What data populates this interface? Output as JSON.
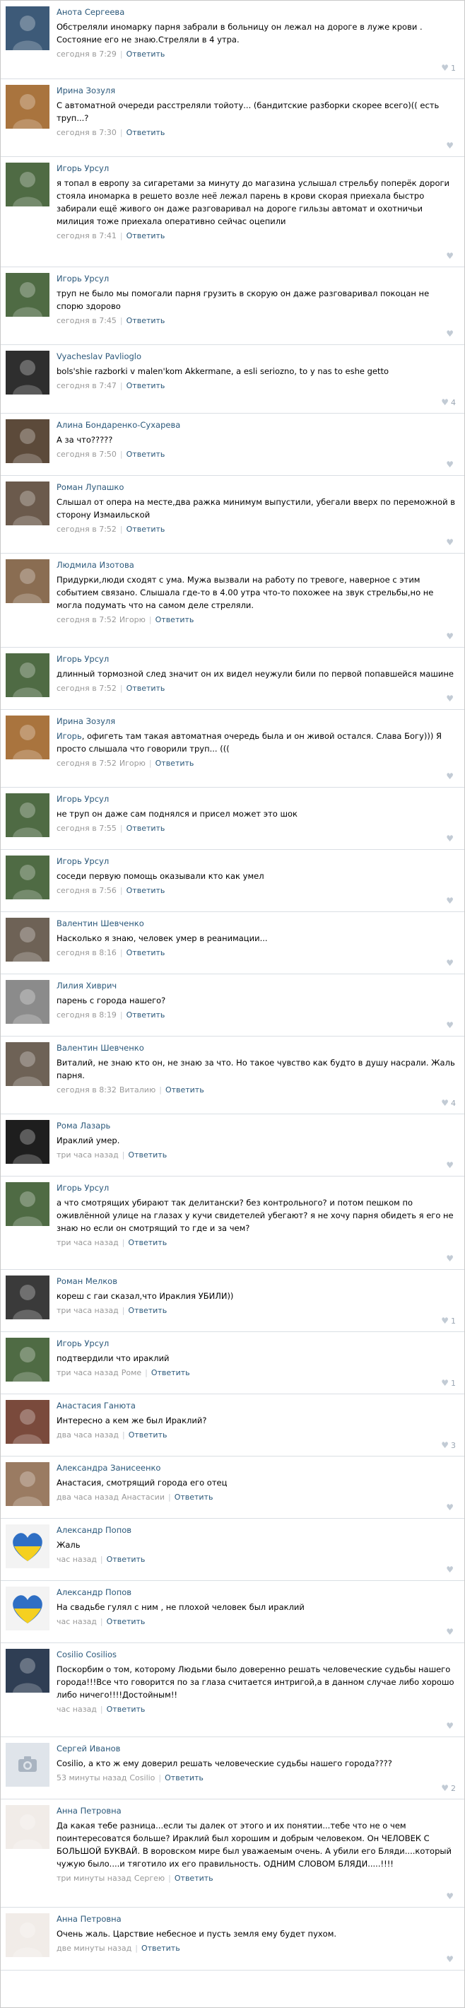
{
  "colors": {
    "link": "#2b587a",
    "meta": "#999999",
    "divider": "#dadfe4",
    "heart": "#c2cbd5"
  },
  "comments": [
    {
      "author": "Анота Сергеева",
      "mention": "",
      "text": "Обстреляли иномарку парня забрали в больницу он лежал на дороге в луже крови . Состояние его не знаю.Стреляли в 4 утра.",
      "time": "сегодня в 7:29",
      "reply_to": "",
      "reply": "Ответить",
      "likes": "1",
      "avatar_icon": "user-photo-icon",
      "avatar_bg": "#3d5a78"
    },
    {
      "author": "Ирина Зозуля",
      "mention": "",
      "text": "С автоматной очереди расстреляли тойоту... (бандитские разборки скорее всего)(( есть труп...?",
      "time": "сегодня в 7:30",
      "reply_to": "",
      "reply": "Ответить",
      "likes": "",
      "avatar_icon": "user-photo-icon",
      "avatar_bg": "#a9743e"
    },
    {
      "author": "Игорь Урсул",
      "mention": "",
      "text": "я топал в европу за сигаретами за минуту до магазина услышал стрельбу поперёк дороги стояла иномарка в решето возле неё лежал парень в крови скорая приехала быстро забирали ещё живого он даже разговаривал на дороге гильзы автомат и охотничьи милиция тоже приехала оперативно сейчас оцепили",
      "time": "сегодня в 7:41",
      "reply_to": "",
      "reply": "Ответить",
      "likes": "",
      "avatar_icon": "user-photo-icon",
      "avatar_bg": "#4f6b44"
    },
    {
      "author": "Игорь Урсул",
      "mention": "",
      "text": "труп не было мы помогали парня грузить в скорую он даже разговаривал покоцан не спорю здорово",
      "time": "сегодня в 7:45",
      "reply_to": "",
      "reply": "Ответить",
      "likes": "",
      "avatar_icon": "user-photo-icon",
      "avatar_bg": "#4f6b44"
    },
    {
      "author": "Vyacheslav Pavlioglo",
      "mention": "",
      "text": "bols'shie razborki v malen'kom Akkermane, a esli seriozno, to y nas to eshe getto",
      "time": "сегодня в 7:47",
      "reply_to": "",
      "reply": "Ответить",
      "likes": "4",
      "avatar_icon": "user-photo-icon",
      "avatar_bg": "#2e2e2e"
    },
    {
      "author": "Алина Бондаренко-Сухарева",
      "mention": "",
      "text": "А за что?????",
      "time": "сегодня в 7:50",
      "reply_to": "",
      "reply": "Ответить",
      "likes": "",
      "avatar_icon": "user-photo-icon",
      "avatar_bg": "#5c4a3a"
    },
    {
      "author": "Роман Лупашко",
      "mention": "",
      "text": "Слышал от опера на месте,два ражка минимум выпустили, убегали вверх по переможной в сторону Измаильской",
      "time": "сегодня в 7:52",
      "reply_to": "",
      "reply": "Ответить",
      "likes": "",
      "avatar_icon": "user-photo-icon",
      "avatar_bg": "#6b5a4c"
    },
    {
      "author": "Людмила Изотова",
      "mention": "",
      "text": "Придурки,люди сходят с ума. Мужа вызвали на работу по тревоге, наверное с этим событием связано. Слышала где-то в 4.00 утра что-то похожее на звук стрельбы,но не могла подумать что на самом деле стреляли.",
      "time": "сегодня в 7:52",
      "reply_to": "Игорю",
      "reply": "Ответить",
      "likes": "",
      "avatar_icon": "user-photo-icon",
      "avatar_bg": "#8a6d52"
    },
    {
      "author": "Игорь Урсул",
      "mention": "",
      "text": "длинный тормозной след значит он их видел неужули били по первой попавшейся машине",
      "time": "сегодня в 7:52",
      "reply_to": "",
      "reply": "Ответить",
      "likes": "",
      "avatar_icon": "user-photo-icon",
      "avatar_bg": "#4f6b44"
    },
    {
      "author": "Ирина Зозуля",
      "mention": "Игорь",
      "text": ", офигеть там такая автоматная очередь была и он живой остался. Слава Богу))) Я просто слышала что говорили труп... (((",
      "time": "сегодня в 7:52",
      "reply_to": "Игорю",
      "reply": "Ответить",
      "likes": "",
      "avatar_icon": "user-photo-icon",
      "avatar_bg": "#a9743e"
    },
    {
      "author": "Игорь Урсул",
      "mention": "",
      "text": "не труп он даже сам поднялся и присел может это шок",
      "time": "сегодня в 7:55",
      "reply_to": "",
      "reply": "Ответить",
      "likes": "",
      "avatar_icon": "user-photo-icon",
      "avatar_bg": "#4f6b44"
    },
    {
      "author": "Игорь Урсул",
      "mention": "",
      "text": "соседи первую помощь оказывали кто как умел",
      "time": "сегодня в 7:56",
      "reply_to": "",
      "reply": "Ответить",
      "likes": "",
      "avatar_icon": "user-photo-icon",
      "avatar_bg": "#4f6b44"
    },
    {
      "author": "Валентин Шевченко",
      "mention": "",
      "text": "Насколько я знаю, человек умер в реанимации...",
      "time": "сегодня в 8:16",
      "reply_to": "",
      "reply": "Ответить",
      "likes": "",
      "avatar_icon": "user-photo-icon",
      "avatar_bg": "#6e6256"
    },
    {
      "author": "Лилия Хиврич",
      "mention": "",
      "text": "парень с города нашего?",
      "time": "сегодня в 8:19",
      "reply_to": "",
      "reply": "Ответить",
      "likes": "",
      "avatar_icon": "user-photo-icon",
      "avatar_bg": "#8b8b8b"
    },
    {
      "author": "Валентин Шевченко",
      "mention": "",
      "text": "Виталий, не знаю кто он, не знаю за что. Но такое чувство как будто в душу насрали. Жаль парня.",
      "time": "сегодня в 8:32",
      "reply_to": "Виталию",
      "reply": "Ответить",
      "likes": "4",
      "avatar_icon": "user-photo-icon",
      "avatar_bg": "#6e6256"
    },
    {
      "author": "Рома Лазарь",
      "mention": "",
      "text": "Ираклий умер.",
      "time": "три часа назад",
      "reply_to": "",
      "reply": "Ответить",
      "likes": "",
      "avatar_icon": "user-photo-icon",
      "avatar_bg": "#1e1e1e"
    },
    {
      "author": "Игорь Урсул",
      "mention": "",
      "text": "а что смотрящих убирают так делитански? без контрольного? и потом пешком по оживлённой улице на глазах у кучи свидетелей убегают? я не хочу парня обидеть я его не знаю но если он смотрящий то где и за чем?",
      "time": "три часа назад",
      "reply_to": "",
      "reply": "Ответить",
      "likes": "",
      "avatar_icon": "user-photo-icon",
      "avatar_bg": "#4f6b44"
    },
    {
      "author": "Роман Мелков",
      "mention": "",
      "text": "кореш с гаи сказал,что Ираклия УБИЛИ))",
      "time": "три часа назад",
      "reply_to": "",
      "reply": "Ответить",
      "likes": "1",
      "avatar_icon": "user-photo-icon",
      "avatar_bg": "#3a3a3a"
    },
    {
      "author": "Игорь Урсул",
      "mention": "",
      "text": "подтвердили что ираклий",
      "time": "три часа назад",
      "reply_to": "Роме",
      "reply": "Ответить",
      "likes": "1",
      "avatar_icon": "user-photo-icon",
      "avatar_bg": "#4f6b44"
    },
    {
      "author": "Анастасия Ганюта",
      "mention": "",
      "text": "Интересно а кем же был Ираклий?",
      "time": "два часа назад",
      "reply_to": "",
      "reply": "Ответить",
      "likes": "3",
      "avatar_icon": "user-photo-icon",
      "avatar_bg": "#7a4a3c"
    },
    {
      "author": "Александра Занисеенко",
      "mention": "",
      "text": "Анастасия, смотрящий города его отец",
      "time": "два часа назад",
      "reply_to": "Анастасии",
      "reply": "Ответить",
      "likes": "",
      "avatar_icon": "user-photo-icon",
      "avatar_bg": "#9a7b62"
    },
    {
      "author": "Александр Попов",
      "mention": "",
      "text": "Жаль",
      "time": "час назад",
      "reply_to": "",
      "reply": "Ответить",
      "likes": "",
      "avatar_icon": "ukraine-heart-icon",
      "avatar_bg": "#f3f3f3"
    },
    {
      "author": "Александр Попов",
      "mention": "",
      "text": "На свадьбе гулял с ним , не плохой человек был ираклий",
      "time": "час назад",
      "reply_to": "",
      "reply": "Ответить",
      "likes": "",
      "avatar_icon": "ukraine-heart-icon",
      "avatar_bg": "#f3f3f3"
    },
    {
      "author": "Cosilio Cosilios",
      "mention": "",
      "text": "Поскорбим о том, которому Людьми было доверенно решать человеческие судьбы нашего города!!!Все что говорится по за глаза считается интригой,а в данном случае либо хорошо либо ничего!!!!Достойным!!",
      "time": "час назад",
      "reply_to": "",
      "reply": "Ответить",
      "likes": "",
      "avatar_icon": "user-photo-icon",
      "avatar_bg": "#2f3e54"
    },
    {
      "author": "Сергей Иванов",
      "mention": "",
      "text": "Cosilio, а кто ж ему доверил решать человеческие судьбы нашего города????",
      "time": "53 минуты назад",
      "reply_to": "Cosilio",
      "reply": "Ответить",
      "likes": "2",
      "avatar_icon": "camera-placeholder-icon",
      "avatar_bg": "#dfe4ea"
    },
    {
      "author": "Анна Петровна",
      "mention": "",
      "text": "Да какая тебе разница...если ты далек от этого и их понятии...тебе что не о чем поинтересоватся больше? Ираклий был хорошим и добрым человеком. Он ЧЕЛОВЕК С БОЛЬШОЙ БУКВАЙ. В воровском мире был уважаемым очень. А убили его Бляди....который чужую было....и тяготило их его правильность. ОДНИМ СЛОВОМ БЛЯДИ.....!!!!",
      "time": "три минуты назад",
      "reply_to": "Сергею",
      "reply": "Ответить",
      "likes": "",
      "avatar_icon": "user-photo-icon",
      "avatar_bg": "#f1ece8"
    },
    {
      "author": "Анна Петровна",
      "mention": "",
      "text": "Очень жаль. Царствие небесное и пусть земля ему будет пухом.",
      "time": "две минуты назад",
      "reply_to": "",
      "reply": "Ответить",
      "likes": "",
      "avatar_icon": "user-photo-icon",
      "avatar_bg": "#f1ece8"
    }
  ]
}
